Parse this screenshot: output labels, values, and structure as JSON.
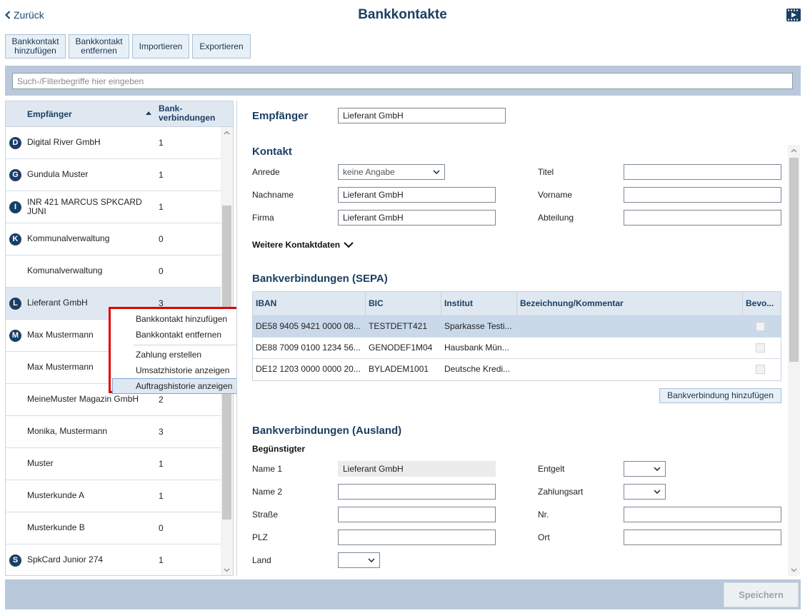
{
  "header": {
    "back_label": "Zurück",
    "title": "Bankkontakte"
  },
  "toolbar": {
    "add_line1": "Bankkontakt",
    "add_line2": "hinzufügen",
    "remove_line1": "Bankkontakt",
    "remove_line2": "entfernen",
    "import_label": "Importieren",
    "export_label": "Exportieren"
  },
  "filter": {
    "placeholder": "Such-/Filterbegriffe hier eingeben"
  },
  "list": {
    "col_recipient": "Empfänger",
    "col_accounts_line1": "Bank-",
    "col_accounts_line2": "verbindungen",
    "rows": [
      {
        "badge": "D",
        "name": "Digital River GmbH",
        "count": "1"
      },
      {
        "badge": "G",
        "name": "Gundula Muster",
        "count": "1"
      },
      {
        "badge": "I",
        "name": "INR 421 MARCUS SPKCARD JUNI",
        "count": "1"
      },
      {
        "badge": "K",
        "name": "Kommunalverwaltung",
        "count": "0"
      },
      {
        "badge": "",
        "name": "Komunalverwaltung",
        "count": "0"
      },
      {
        "badge": "L",
        "name": "Lieferant GmbH",
        "count": "3"
      },
      {
        "badge": "M",
        "name": "Max Mustermann",
        "count": ""
      },
      {
        "badge": "",
        "name": "Max Mustermann",
        "count": ""
      },
      {
        "badge": "",
        "name": "MeineMuster Magazin GmbH",
        "count": "2"
      },
      {
        "badge": "",
        "name": "Monika, Mustermann",
        "count": "3"
      },
      {
        "badge": "",
        "name": "Muster",
        "count": "1"
      },
      {
        "badge": "",
        "name": "Musterkunde A",
        "count": "1"
      },
      {
        "badge": "",
        "name": "Musterkunde B",
        "count": "0"
      },
      {
        "badge": "S",
        "name": "SpkCard Junior 274",
        "count": "1"
      }
    ]
  },
  "context_menu": {
    "items": [
      "Bankkontakt hinzufügen",
      "Bankkontakt entfernen",
      "Zahlung erstellen",
      "Umsatzhistorie anzeigen",
      "Auftragshistorie anzeigen"
    ]
  },
  "detail": {
    "recipient_label": "Empfänger",
    "recipient_value": "Lieferant GmbH",
    "contact_section": "Kontakt",
    "salutation_label": "Anrede",
    "salutation_value": "keine Angabe",
    "title_label": "Titel",
    "title_value": "",
    "lastname_label": "Nachname",
    "lastname_value": "Lieferant GmbH",
    "firstname_label": "Vorname",
    "firstname_value": "",
    "company_label": "Firma",
    "company_value": "Lieferant GmbH",
    "department_label": "Abteilung",
    "department_value": "",
    "more_contact": "Weitere Kontaktdaten",
    "sepa_section": "Bankverbindungen (SEPA)",
    "sepa_columns": [
      "IBAN",
      "BIC",
      "Institut",
      "Bezeichnung/Kommentar",
      "Bevo..."
    ],
    "sepa_rows": [
      {
        "iban": "DE58 9405 9421 0000 08...",
        "bic": "TESTDETT421",
        "institute": "Sparkasse Testi...",
        "comment": ""
      },
      {
        "iban": "DE88 7009 0100 1234 56...",
        "bic": "GENODEF1M04",
        "institute": "Hausbank Mün...",
        "comment": ""
      },
      {
        "iban": "DE12 1203 0000 0000 20...",
        "bic": "BYLADEM1001",
        "institute": "Deutsche Kredi...",
        "comment": ""
      }
    ],
    "add_bank_button": "Bankverbindung hinzufügen",
    "foreign_section": "Bankverbindungen (Ausland)",
    "beneficiary": "Begünstigter",
    "name1_label": "Name 1",
    "name1_value": "Lieferant GmbH",
    "fee_label": "Entgelt",
    "name2_label": "Name 2",
    "payment_type_label": "Zahlungsart",
    "street_label": "Straße",
    "nr_label": "Nr.",
    "zip_label": "PLZ",
    "city_label": "Ort",
    "country_label": "Land"
  },
  "footer": {
    "save_label": "Speichern"
  },
  "colors": {
    "primary": "#1b3f63",
    "bar": "#b9c9db",
    "highlight_border": "#e00000"
  }
}
